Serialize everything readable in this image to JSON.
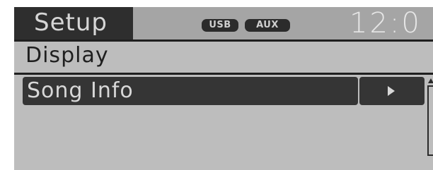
{
  "header": {
    "title": "Setup",
    "badges": {
      "usb": "USB",
      "aux": "AUX"
    },
    "clock": "12:0"
  },
  "page": {
    "section_title": "Display"
  },
  "menu": {
    "items": [
      {
        "label": "Song Info"
      }
    ]
  },
  "icons": {
    "arrow": "play-arrow-icon",
    "scroll_up": "chevron-up-icon"
  },
  "colors": {
    "screen_background": "#bdbdbd",
    "status_bar": "#a5a5a5",
    "title_box": "#2e2e2e",
    "selected_item": "#353535",
    "text_light": "#d8d8d8",
    "text_dark": "#1f1f1f"
  }
}
